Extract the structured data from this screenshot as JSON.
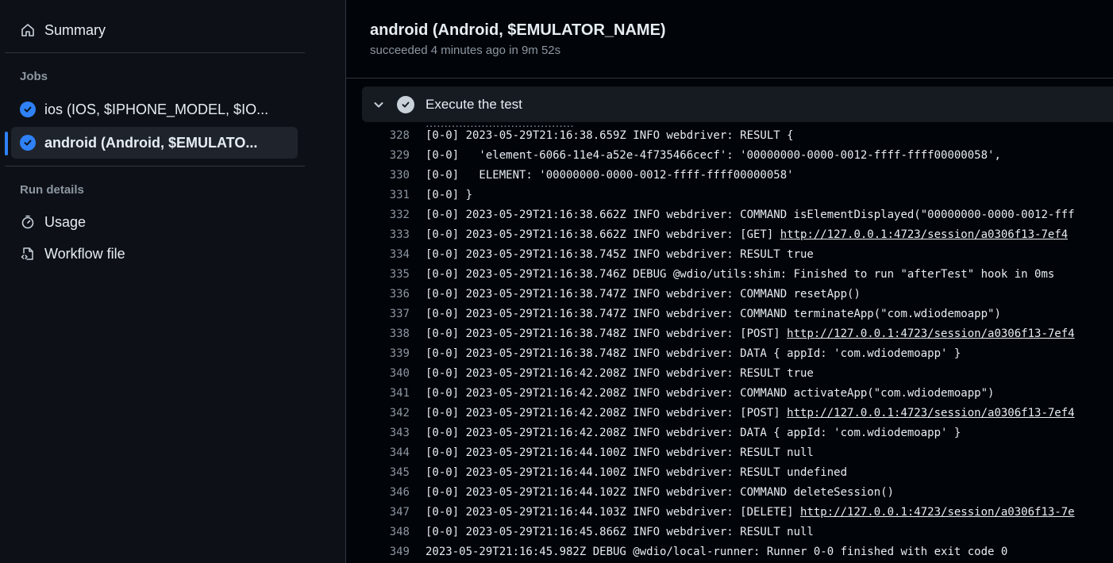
{
  "sidebar": {
    "summary_label": "Summary",
    "jobs_heading": "Jobs",
    "jobs": [
      {
        "label": "ios (IOS, $IPHONE_MODEL, $IO...",
        "status": "success"
      },
      {
        "label": "android (Android, $EMULATO...",
        "status": "success",
        "active": true
      }
    ],
    "run_details_heading": "Run details",
    "usage_label": "Usage",
    "workflow_label": "Workflow file"
  },
  "job": {
    "title": "android (Android, $EMULATOR_NAME)",
    "subtitle": "succeeded 4 minutes ago in 9m 52s"
  },
  "step": {
    "title": "Execute the test"
  },
  "log_lines": [
    {
      "num": "328",
      "text": "[0-0] 2023-05-29T21:16:38.659Z INFO webdriver: RESULT {"
    },
    {
      "num": "329",
      "text": "[0-0]   'element-6066-11e4-a52e-4f735466cecf': '00000000-0000-0012-ffff-ffff00000058',"
    },
    {
      "num": "330",
      "text": "[0-0]   ELEMENT: '00000000-0000-0012-ffff-ffff00000058'"
    },
    {
      "num": "331",
      "text": "[0-0] }"
    },
    {
      "num": "332",
      "text": "[0-0] 2023-05-29T21:16:38.662Z INFO webdriver: COMMAND isElementDisplayed(\"00000000-0000-0012-fff"
    },
    {
      "num": "333",
      "text": "[0-0] 2023-05-29T21:16:38.662Z INFO webdriver: [GET] ",
      "link": "http://127.0.0.1:4723/session/a0306f13-7ef4"
    },
    {
      "num": "334",
      "text": "[0-0] 2023-05-29T21:16:38.745Z INFO webdriver: RESULT true"
    },
    {
      "num": "335",
      "text": "[0-0] 2023-05-29T21:16:38.746Z DEBUG @wdio/utils:shim: Finished to run \"afterTest\" hook in 0ms"
    },
    {
      "num": "336",
      "text": "[0-0] 2023-05-29T21:16:38.747Z INFO webdriver: COMMAND resetApp()"
    },
    {
      "num": "337",
      "text": "[0-0] 2023-05-29T21:16:38.747Z INFO webdriver: COMMAND terminateApp(\"com.wdiodemoapp\")"
    },
    {
      "num": "338",
      "text": "[0-0] 2023-05-29T21:16:38.748Z INFO webdriver: [POST] ",
      "link": "http://127.0.0.1:4723/session/a0306f13-7ef4"
    },
    {
      "num": "339",
      "text": "[0-0] 2023-05-29T21:16:38.748Z INFO webdriver: DATA { appId: 'com.wdiodemoapp' }"
    },
    {
      "num": "340",
      "text": "[0-0] 2023-05-29T21:16:42.208Z INFO webdriver: RESULT true"
    },
    {
      "num": "341",
      "text": "[0-0] 2023-05-29T21:16:42.208Z INFO webdriver: COMMAND activateApp(\"com.wdiodemoapp\")"
    },
    {
      "num": "342",
      "text": "[0-0] 2023-05-29T21:16:42.208Z INFO webdriver: [POST] ",
      "link": "http://127.0.0.1:4723/session/a0306f13-7ef4"
    },
    {
      "num": "343",
      "text": "[0-0] 2023-05-29T21:16:42.208Z INFO webdriver: DATA { appId: 'com.wdiodemoapp' }"
    },
    {
      "num": "344",
      "text": "[0-0] 2023-05-29T21:16:44.100Z INFO webdriver: RESULT null"
    },
    {
      "num": "345",
      "text": "[0-0] 2023-05-29T21:16:44.100Z INFO webdriver: RESULT undefined"
    },
    {
      "num": "346",
      "text": "[0-0] 2023-05-29T21:16:44.102Z INFO webdriver: COMMAND deleteSession()"
    },
    {
      "num": "347",
      "text": "[0-0] 2023-05-29T21:16:44.103Z INFO webdriver: [DELETE] ",
      "link": "http://127.0.0.1:4723/session/a0306f13-7e"
    },
    {
      "num": "348",
      "text": "[0-0] 2023-05-29T21:16:45.866Z INFO webdriver: RESULT null"
    },
    {
      "num": "349",
      "text": "2023-05-29T21:16:45.982Z DEBUG @wdio/local-runner: Runner 0-0 finished with exit code 0"
    }
  ],
  "colors": {
    "accent": "#2f81f7",
    "background": "#010409",
    "sidebar": "#0d1117",
    "text": "#e6edf3",
    "muted": "#8d96a0"
  }
}
